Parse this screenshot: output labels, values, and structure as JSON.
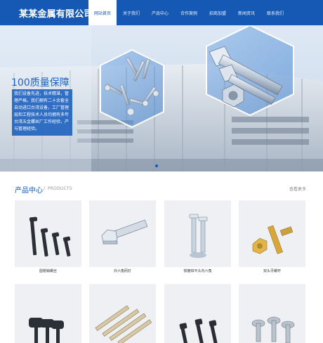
{
  "header": {
    "logo": "某某金属有限公司",
    "nav": [
      {
        "label": "网站首页",
        "active": true
      },
      {
        "label": "关于我们"
      },
      {
        "label": "产品中心"
      },
      {
        "label": "合作案例"
      },
      {
        "label": "招商加盟"
      },
      {
        "label": "新闻资讯"
      },
      {
        "label": "联系我们"
      }
    ]
  },
  "banner": {
    "title": "100质量保障",
    "text": "我们设备先进，技术精湛，管理严格。我们拥有二十余套全自动进口台湾设备，工厂管理层和工程技术人员均拥有多年台湾五金螺丝厂工作经验，产与管理经验。"
  },
  "products": {
    "title": "产品中心",
    "slash": "/",
    "subtitle": "PRODUCTS",
    "more": "查看更多",
    "items": [
      {
        "name": "圆帽销螺丝",
        "icon": "black-shoulder-bolts"
      },
      {
        "name": "外六角而钉",
        "icon": "hex-bolt"
      },
      {
        "name": "铁镀锌平头内六角",
        "icon": "zinc-hex-socket-screw"
      },
      {
        "name": "双头牙螺杆",
        "icon": "double-thread-stud"
      },
      {
        "name": "",
        "icon": "black-flat-screws"
      },
      {
        "name": "",
        "icon": "tapping-screws"
      },
      {
        "name": "",
        "icon": "black-machine-screws"
      },
      {
        "name": "",
        "icon": "flange-screws"
      }
    ]
  }
}
